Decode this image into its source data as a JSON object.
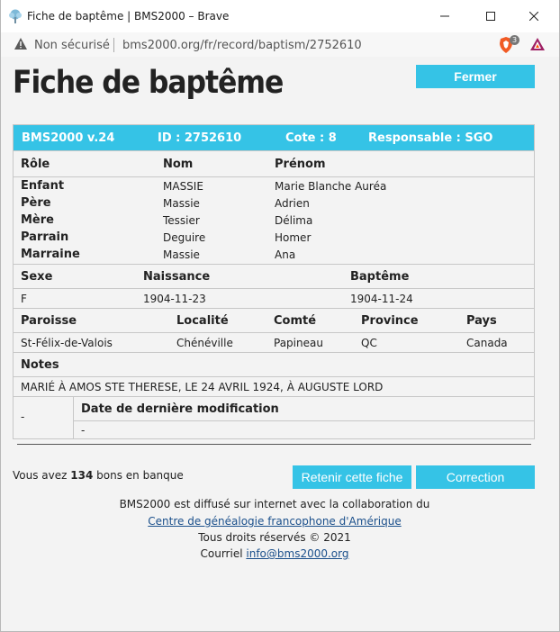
{
  "window": {
    "title": "Fiche de baptême | BMS2000 – Brave"
  },
  "addressbar": {
    "security_label": "Non sécurisé",
    "url": "bms2000.org/fr/record/baptism/2752610",
    "shield_count": "3"
  },
  "page": {
    "title": "Fiche de baptême",
    "close_label": "Fermer"
  },
  "record": {
    "version": "BMS2000 v.24",
    "id": "ID : 2752610",
    "cote": "Cote : 8",
    "responsable": "Responsable : SGO",
    "persons_headers": {
      "role": "Rôle",
      "nom": "Nom",
      "prenom": "Prénom"
    },
    "persons": [
      {
        "role": "Enfant",
        "nom": "MASSIE",
        "prenom": "Marie Blanche Auréa"
      },
      {
        "role": "Père",
        "nom": "Massie",
        "prenom": "Adrien"
      },
      {
        "role": "Mère",
        "nom": "Tessier",
        "prenom": "Délima"
      },
      {
        "role": "Parrain",
        "nom": "Deguire",
        "prenom": "Homer"
      },
      {
        "role": "Marraine",
        "nom": "Massie",
        "prenom": "Ana"
      }
    ],
    "vitals_headers": {
      "sexe": "Sexe",
      "naissance": "Naissance",
      "bapteme": "Baptême"
    },
    "vitals": {
      "sexe": "F",
      "naissance": "1904-11-23",
      "bapteme": "1904-11-24"
    },
    "place_headers": {
      "paroisse": "Paroisse",
      "localite": "Localité",
      "comte": "Comté",
      "province": "Province",
      "pays": "Pays"
    },
    "place": {
      "paroisse": "St-Félix-de-Valois",
      "localite": "Chénéville",
      "comte": "Papineau",
      "province": "QC",
      "pays": "Canada"
    },
    "notes_header": "Notes",
    "notes": "MARIÉ À AMOS STE THERESE, LE 24 AVRIL 1924, À AUGUSTE LORD",
    "mod_left": "-",
    "mod_header": "Date de dernière modification",
    "mod_value": "-"
  },
  "bank": {
    "prefix": "Vous avez",
    "count": "134",
    "suffix": "bons en banque"
  },
  "actions": {
    "retain_label": "Retenir cette fiche",
    "correction_label": "Correction"
  },
  "footer": {
    "line1": "BMS2000 est diffusé sur internet avec la collaboration du",
    "link1": "Centre de généalogie francophone d'Amérique",
    "line3": "Tous droits réservés © 2021",
    "contact_prefix": "Courriel",
    "email": "info@bms2000.org"
  },
  "colors": {
    "accent": "#35c3e6",
    "link": "#1a4f8b"
  }
}
